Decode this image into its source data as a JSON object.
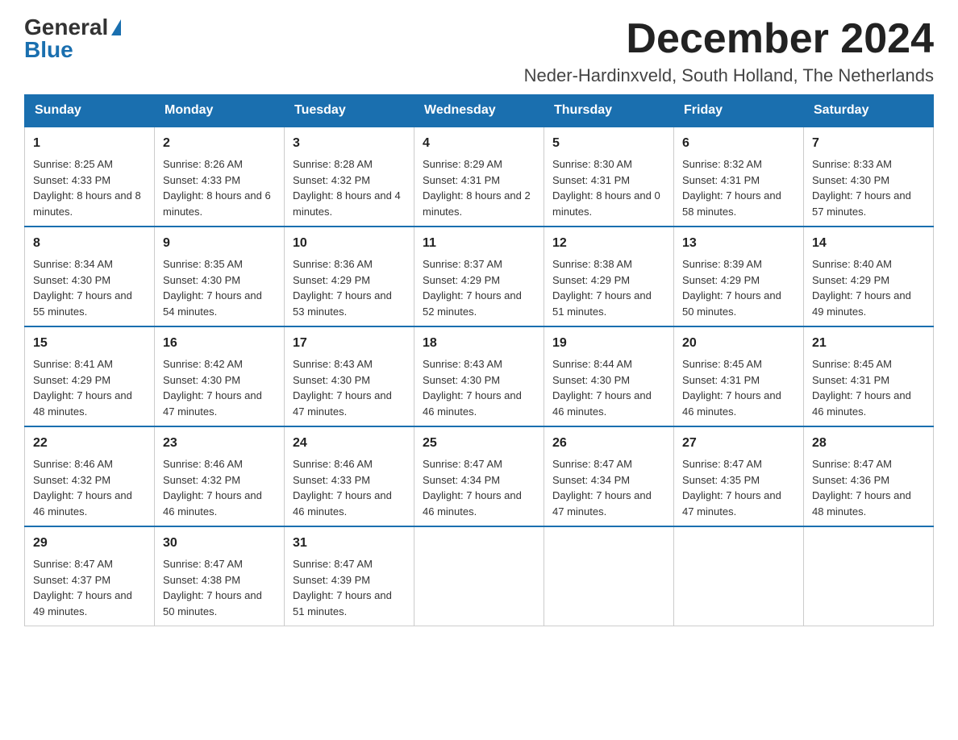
{
  "header": {
    "logo_general": "General",
    "logo_blue": "Blue",
    "month_year": "December 2024",
    "location": "Neder-Hardinxveld, South Holland, The Netherlands"
  },
  "days_of_week": [
    "Sunday",
    "Monday",
    "Tuesday",
    "Wednesday",
    "Thursday",
    "Friday",
    "Saturday"
  ],
  "weeks": [
    [
      {
        "day": "1",
        "sunrise": "8:25 AM",
        "sunset": "4:33 PM",
        "daylight": "8 hours and 8 minutes."
      },
      {
        "day": "2",
        "sunrise": "8:26 AM",
        "sunset": "4:33 PM",
        "daylight": "8 hours and 6 minutes."
      },
      {
        "day": "3",
        "sunrise": "8:28 AM",
        "sunset": "4:32 PM",
        "daylight": "8 hours and 4 minutes."
      },
      {
        "day": "4",
        "sunrise": "8:29 AM",
        "sunset": "4:31 PM",
        "daylight": "8 hours and 2 minutes."
      },
      {
        "day": "5",
        "sunrise": "8:30 AM",
        "sunset": "4:31 PM",
        "daylight": "8 hours and 0 minutes."
      },
      {
        "day": "6",
        "sunrise": "8:32 AM",
        "sunset": "4:31 PM",
        "daylight": "7 hours and 58 minutes."
      },
      {
        "day": "7",
        "sunrise": "8:33 AM",
        "sunset": "4:30 PM",
        "daylight": "7 hours and 57 minutes."
      }
    ],
    [
      {
        "day": "8",
        "sunrise": "8:34 AM",
        "sunset": "4:30 PM",
        "daylight": "7 hours and 55 minutes."
      },
      {
        "day": "9",
        "sunrise": "8:35 AM",
        "sunset": "4:30 PM",
        "daylight": "7 hours and 54 minutes."
      },
      {
        "day": "10",
        "sunrise": "8:36 AM",
        "sunset": "4:29 PM",
        "daylight": "7 hours and 53 minutes."
      },
      {
        "day": "11",
        "sunrise": "8:37 AM",
        "sunset": "4:29 PM",
        "daylight": "7 hours and 52 minutes."
      },
      {
        "day": "12",
        "sunrise": "8:38 AM",
        "sunset": "4:29 PM",
        "daylight": "7 hours and 51 minutes."
      },
      {
        "day": "13",
        "sunrise": "8:39 AM",
        "sunset": "4:29 PM",
        "daylight": "7 hours and 50 minutes."
      },
      {
        "day": "14",
        "sunrise": "8:40 AM",
        "sunset": "4:29 PM",
        "daylight": "7 hours and 49 minutes."
      }
    ],
    [
      {
        "day": "15",
        "sunrise": "8:41 AM",
        "sunset": "4:29 PM",
        "daylight": "7 hours and 48 minutes."
      },
      {
        "day": "16",
        "sunrise": "8:42 AM",
        "sunset": "4:30 PM",
        "daylight": "7 hours and 47 minutes."
      },
      {
        "day": "17",
        "sunrise": "8:43 AM",
        "sunset": "4:30 PM",
        "daylight": "7 hours and 47 minutes."
      },
      {
        "day": "18",
        "sunrise": "8:43 AM",
        "sunset": "4:30 PM",
        "daylight": "7 hours and 46 minutes."
      },
      {
        "day": "19",
        "sunrise": "8:44 AM",
        "sunset": "4:30 PM",
        "daylight": "7 hours and 46 minutes."
      },
      {
        "day": "20",
        "sunrise": "8:45 AM",
        "sunset": "4:31 PM",
        "daylight": "7 hours and 46 minutes."
      },
      {
        "day": "21",
        "sunrise": "8:45 AM",
        "sunset": "4:31 PM",
        "daylight": "7 hours and 46 minutes."
      }
    ],
    [
      {
        "day": "22",
        "sunrise": "8:46 AM",
        "sunset": "4:32 PM",
        "daylight": "7 hours and 46 minutes."
      },
      {
        "day": "23",
        "sunrise": "8:46 AM",
        "sunset": "4:32 PM",
        "daylight": "7 hours and 46 minutes."
      },
      {
        "day": "24",
        "sunrise": "8:46 AM",
        "sunset": "4:33 PM",
        "daylight": "7 hours and 46 minutes."
      },
      {
        "day": "25",
        "sunrise": "8:47 AM",
        "sunset": "4:34 PM",
        "daylight": "7 hours and 46 minutes."
      },
      {
        "day": "26",
        "sunrise": "8:47 AM",
        "sunset": "4:34 PM",
        "daylight": "7 hours and 47 minutes."
      },
      {
        "day": "27",
        "sunrise": "8:47 AM",
        "sunset": "4:35 PM",
        "daylight": "7 hours and 47 minutes."
      },
      {
        "day": "28",
        "sunrise": "8:47 AM",
        "sunset": "4:36 PM",
        "daylight": "7 hours and 48 minutes."
      }
    ],
    [
      {
        "day": "29",
        "sunrise": "8:47 AM",
        "sunset": "4:37 PM",
        "daylight": "7 hours and 49 minutes."
      },
      {
        "day": "30",
        "sunrise": "8:47 AM",
        "sunset": "4:38 PM",
        "daylight": "7 hours and 50 minutes."
      },
      {
        "day": "31",
        "sunrise": "8:47 AM",
        "sunset": "4:39 PM",
        "daylight": "7 hours and 51 minutes."
      },
      null,
      null,
      null,
      null
    ]
  ],
  "labels": {
    "sunrise": "Sunrise:",
    "sunset": "Sunset:",
    "daylight": "Daylight:"
  }
}
